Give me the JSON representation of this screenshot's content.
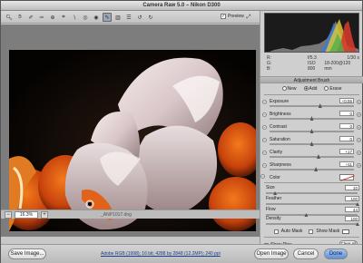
{
  "window": {
    "title": "Camera Raw 5.0  –  Nikon D300"
  },
  "toolbar": {
    "tools": [
      "zoom-icon",
      "hand-icon",
      "white-balance-icon",
      "color-sampler-icon",
      "target-adjust-icon",
      "crop-icon",
      "straighten-icon",
      "spot-removal-icon",
      "red-eye-icon",
      "adjustment-brush-icon",
      "graduated-filter-icon",
      "preferences-icon",
      "rotate-left-icon",
      "rotate-right-icon"
    ],
    "preview_label": "Preview",
    "preview_checked": true
  },
  "status": {
    "zoom_value": "16.3%",
    "filename": "_ANP1017.dng"
  },
  "readout": {
    "r_label": "R:",
    "g_label": "G:",
    "b_label": "B:",
    "aperture": "f/5.3",
    "shutter": "1/30 s",
    "iso": "ISO 800",
    "focal": "18-200@120 mm"
  },
  "panel": {
    "title": "Adjustment Brush",
    "modes": [
      {
        "label": "New",
        "selected": false
      },
      {
        "label": "Add",
        "selected": true
      },
      {
        "label": "Erase",
        "selected": false
      }
    ],
    "sliders": [
      {
        "label": "Exposure",
        "value": "+0.55",
        "position": 0.6
      },
      {
        "label": "Brightness",
        "value": "0",
        "position": 0.5
      },
      {
        "label": "Contrast",
        "value": "0",
        "position": 0.5
      },
      {
        "label": "Saturation",
        "value": "0",
        "position": 0.5
      },
      {
        "label": "Clarity",
        "value": "+17",
        "position": 0.58
      },
      {
        "label": "Sharpness",
        "value": "+11",
        "position": 0.55
      }
    ],
    "color_label": "Color",
    "brush": [
      {
        "label": "Size",
        "value": "10",
        "position": 0.1
      },
      {
        "label": "Feather",
        "value": "100",
        "position": 1.0
      },
      {
        "label": "Flow",
        "value": "44",
        "position": 0.44
      },
      {
        "label": "Density",
        "value": "100",
        "position": 1.0
      }
    ],
    "auto_mask_label": "Auto Mask",
    "show_mask_label": "Show Mask",
    "show_pins_label": "Show Pins",
    "clear_all_label": "Clear All"
  },
  "footer": {
    "save_label": "Save Image...",
    "workflow": "Adobe RGB (1998); 16 bit; 4288 by 2848 (12.2MP); 240 ppi",
    "open_label": "Open Image",
    "cancel_label": "Cancel",
    "done_label": "Done"
  }
}
